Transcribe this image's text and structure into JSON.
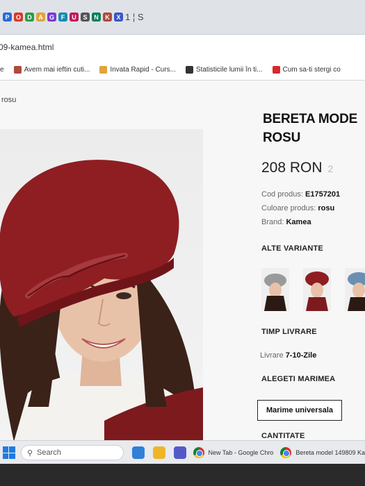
{
  "browser": {
    "tab_icons": [
      "P",
      "O",
      "D",
      "A",
      "G",
      "F",
      "U",
      "S",
      "N",
      "K",
      "X"
    ],
    "tab_text": "1 ¦ S",
    "url": "09-kamea.html",
    "bookmarks": [
      {
        "label": "e",
        "icon_color": "#555555"
      },
      {
        "label": "Avem mai ieftin cuti...",
        "icon_color": "#b04a3a"
      },
      {
        "label": "Invata Rapid - Curs...",
        "icon_color": "#e0a43a"
      },
      {
        "label": "Statisticile lumii în ti...",
        "icon_color": "#333333"
      },
      {
        "label": "Cum sa-ti stergi co",
        "icon_color": "#d62a2a"
      }
    ]
  },
  "page": {
    "breadcrumb": "rosu",
    "product": {
      "title_line1": "BERETA MODE",
      "title_line2": "ROSU",
      "price": "208 RON",
      "price_old": "2",
      "meta": [
        {
          "label": "Cod produs:",
          "value": "E1757201"
        },
        {
          "label": "Culoare produs:",
          "value": "rosu"
        },
        {
          "label": "Brand:",
          "value": "Kamea"
        }
      ],
      "variants_heading": "ALTE VARIANTE",
      "variants": [
        {
          "name": "gri",
          "color": "#9a9a9a"
        },
        {
          "name": "rosu",
          "color": "#8e1e22"
        },
        {
          "name": "albastru",
          "color": "#6b8fb3"
        }
      ],
      "delivery_heading": "TIMP LIVRARE",
      "delivery_label": "Livrare",
      "delivery_value": "7-10-Zile",
      "size_heading": "ALEGETI MARIMEA",
      "size_option": "Marime universala",
      "quantity_heading": "CANTITATE"
    }
  },
  "taskbar": {
    "search_placeholder": "Search",
    "tasks": [
      {
        "label": "New Tab - Google Chro"
      },
      {
        "label": "Bereta model 149809 Ka"
      }
    ]
  },
  "colors": {
    "beret": "#8e1e22",
    "hair": "#3a2218",
    "skin": "#e8c2a8",
    "scarf": "#7d1a1e"
  }
}
